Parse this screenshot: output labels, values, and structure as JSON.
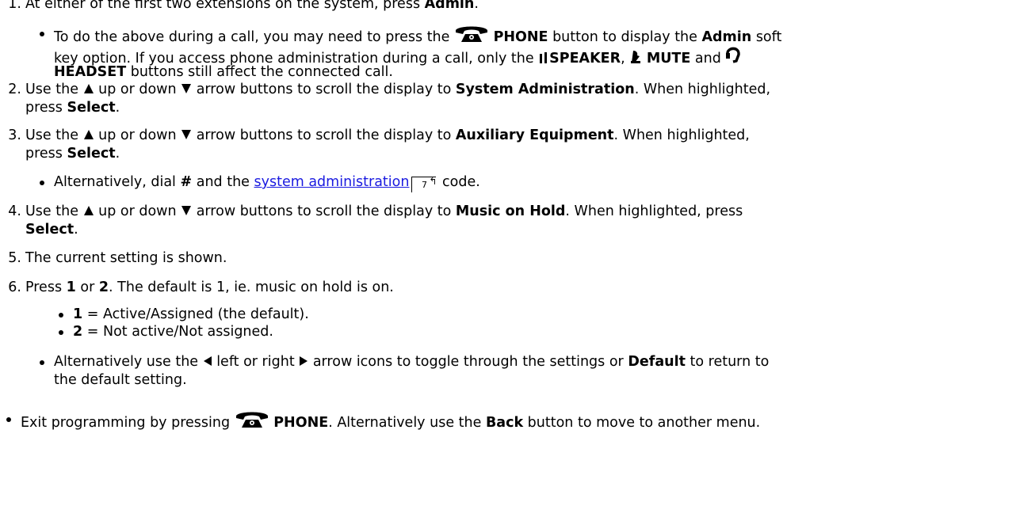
{
  "steps": [
    {
      "num": "1.",
      "pre": "At either of the first two extensions on the system, press ",
      "bold": "Admin",
      "post": "."
    },
    {
      "num": "2.",
      "pre": "Use the ",
      "mid": " up or down ",
      "post1": " arrow buttons to scroll the display to ",
      "bold": "System Administration",
      "post2": ". When highlighted,",
      "line2_pre": "press ",
      "line2_bold": "Select",
      "line2_post": "."
    },
    {
      "num": "3.",
      "pre": "Use the ",
      "mid": " up or down ",
      "post1": " arrow buttons to scroll the display to ",
      "bold": "Auxiliary Equipment",
      "post2": ". When highlighted,",
      "line2_pre": "press ",
      "line2_bold": "Select",
      "line2_post": "."
    },
    {
      "num": "4.",
      "pre": "Use the ",
      "mid": " up or down ",
      "post1": " arrow buttons to scroll the display to ",
      "bold": "Music on Hold",
      "post2": ". When highlighted, press",
      "line2_bold": "Select",
      "line2_post": "."
    },
    {
      "num": "5.",
      "text": "The current setting is shown."
    },
    {
      "num": "6.",
      "pre": "Press ",
      "b1": "1",
      "or": " or ",
      "b2": "2",
      "post": ". The default is 1, ie. music on hold is on."
    }
  ],
  "note1": {
    "pre": "To do the above during a call, you may need to press the ",
    "phone": "PHONE",
    "mid": " button to display the ",
    "admin": "Admin",
    "end": " soft",
    "line2_pre": "key option. If you access phone administration during a call, only the ",
    "speaker": "SPEAKER",
    "comma": ", ",
    "mute": "MUTE",
    "and": " and",
    "headset": "HEADSET",
    "line3_post": " buttons still affect the connected call."
  },
  "note3": {
    "pre": "Alternatively, dial ",
    "hash": "#",
    "mid": " and the ",
    "link": "system administration",
    "ref": "7",
    "post": " code."
  },
  "options": [
    {
      "key": "1",
      "text": " = Active/Assigned (the default)."
    },
    {
      "key": "2",
      "text": " = Not active/Not assigned."
    }
  ],
  "note6": {
    "pre": "Alternatively use the ",
    "mid": " left or right ",
    "post1": " arrow icons to toggle through the settings or ",
    "bold": "Default",
    "post2": " to return to",
    "line2": "the default setting."
  },
  "exit": {
    "pre": "Exit programming by pressing ",
    "phone": "PHONE",
    "mid": ". Alternatively use the ",
    "back": "Back",
    "post": " button to move to another menu."
  }
}
